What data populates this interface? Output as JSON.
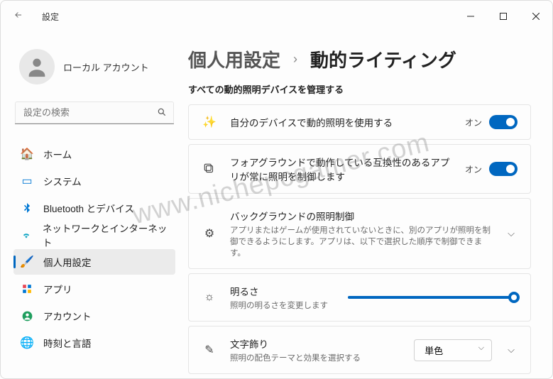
{
  "window": {
    "title": "設定"
  },
  "profile": {
    "name": "ローカル アカウント"
  },
  "search": {
    "placeholder": "設定の検索"
  },
  "nav": {
    "home": "ホーム",
    "system": "システム",
    "bluetooth": "Bluetooth とデバイス",
    "network": "ネットワークとインターネット",
    "personalization": "個人用設定",
    "apps": "アプリ",
    "accounts": "アカウント",
    "time": "時刻と言語"
  },
  "breadcrumb": {
    "parent": "個人用設定",
    "current": "動的ライティング"
  },
  "subtitle": "すべての動的照明デバイスを管理する",
  "rows": {
    "r1": {
      "title": "自分のデバイスで動的照明を使用する",
      "state": "オン"
    },
    "r2": {
      "title": "フォアグラウンドで動作している互換性のあるアプリが常に照明を制御します",
      "state": "オン"
    },
    "r3": {
      "title": "バックグラウンドの照明制御",
      "desc": "アプリまたはゲームが使用されていないときに、別のアプリが照明を制御できるようにします。アプリは、以下で選択した順序で制御できます。"
    },
    "r4": {
      "title": "明るさ",
      "desc": "照明の明るさを変更します"
    },
    "r5": {
      "title": "文字飾り",
      "desc": "照明の配色テーマと効果を選択する",
      "value": "単色"
    }
  },
  "watermark": "www.nichepcgamer.com"
}
